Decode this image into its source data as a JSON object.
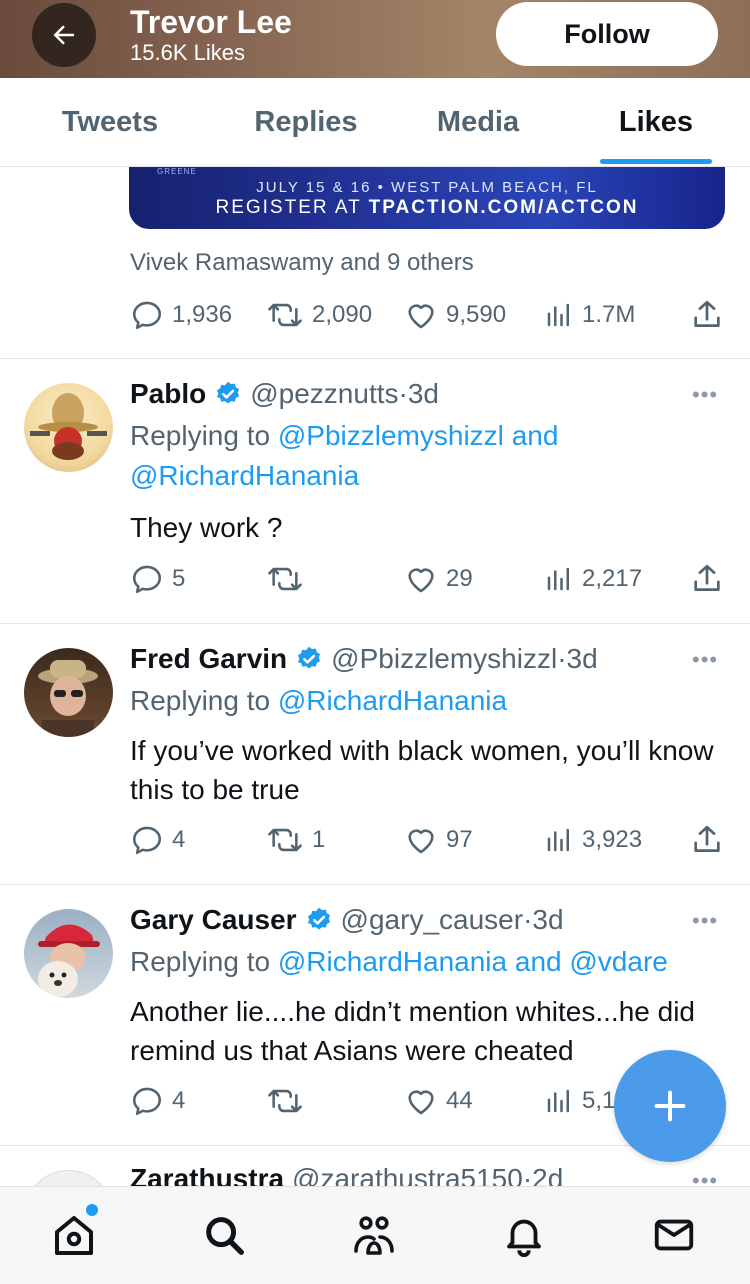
{
  "header": {
    "name": "Trevor Lee",
    "subtitle": "15.6K Likes",
    "follow_label": "Follow"
  },
  "tabs": [
    {
      "label": "Tweets",
      "active": false
    },
    {
      "label": "Replies",
      "active": false
    },
    {
      "label": "Media",
      "active": false
    },
    {
      "label": "Likes",
      "active": true
    }
  ],
  "banner": {
    "top_names": "GREENE",
    "line1": "JULY 15 & 16   •   WEST PALM BEACH, FL",
    "line2_prefix": "REGISTER AT",
    "line2_url": "TPACTION.COM/ACTCON"
  },
  "first_tweet": {
    "liked_by": "Vivek Ramaswamy and 9 others",
    "replies": "1,936",
    "retweets": "2,090",
    "likes": "9,590",
    "views": "1.7M"
  },
  "tweets": [
    {
      "name": "Pablo",
      "handle": "@pezznutts",
      "time": "3d",
      "replying_prefix": "Replying to",
      "mention1": "@Pbizzlemyshizzl",
      "joiner": "and",
      "mention2": "@RichardHanania",
      "text": "They work ?",
      "replies": "5",
      "retweets": "",
      "likes": "29",
      "views": "2,217"
    },
    {
      "name": "Fred Garvin",
      "handle": "@Pbizzlemyshizzl",
      "time": "3d",
      "replying_prefix": "Replying to",
      "mention1": "@RichardHanania",
      "text": "If you’ve worked with black women, you’ll know this to be true",
      "replies": "4",
      "retweets": "1",
      "likes": "97",
      "views": "3,923"
    },
    {
      "name": "Gary Causer",
      "handle": "@gary_causer",
      "time": "3d",
      "replying_prefix": "Replying to",
      "mention1": "@RichardHanania",
      "joiner": "and",
      "mention2": "@vdare",
      "text": "Another lie....he didn’t mention whites...he did remind us that Asians were cheated",
      "replies": "4",
      "retweets": "",
      "likes": "44",
      "views": "5,1"
    },
    {
      "name": "Zarathustra",
      "handle": "@zarathustra5150",
      "time": "2d"
    }
  ],
  "more_glyph": "•••",
  "separator": "·",
  "colors": {
    "accent": "#1d9bf0",
    "fab": "#4c9bea",
    "secondary_text": "#536471"
  },
  "bottom_nav": [
    "home-icon",
    "search-icon",
    "communities-icon",
    "bell-icon",
    "mail-icon"
  ]
}
